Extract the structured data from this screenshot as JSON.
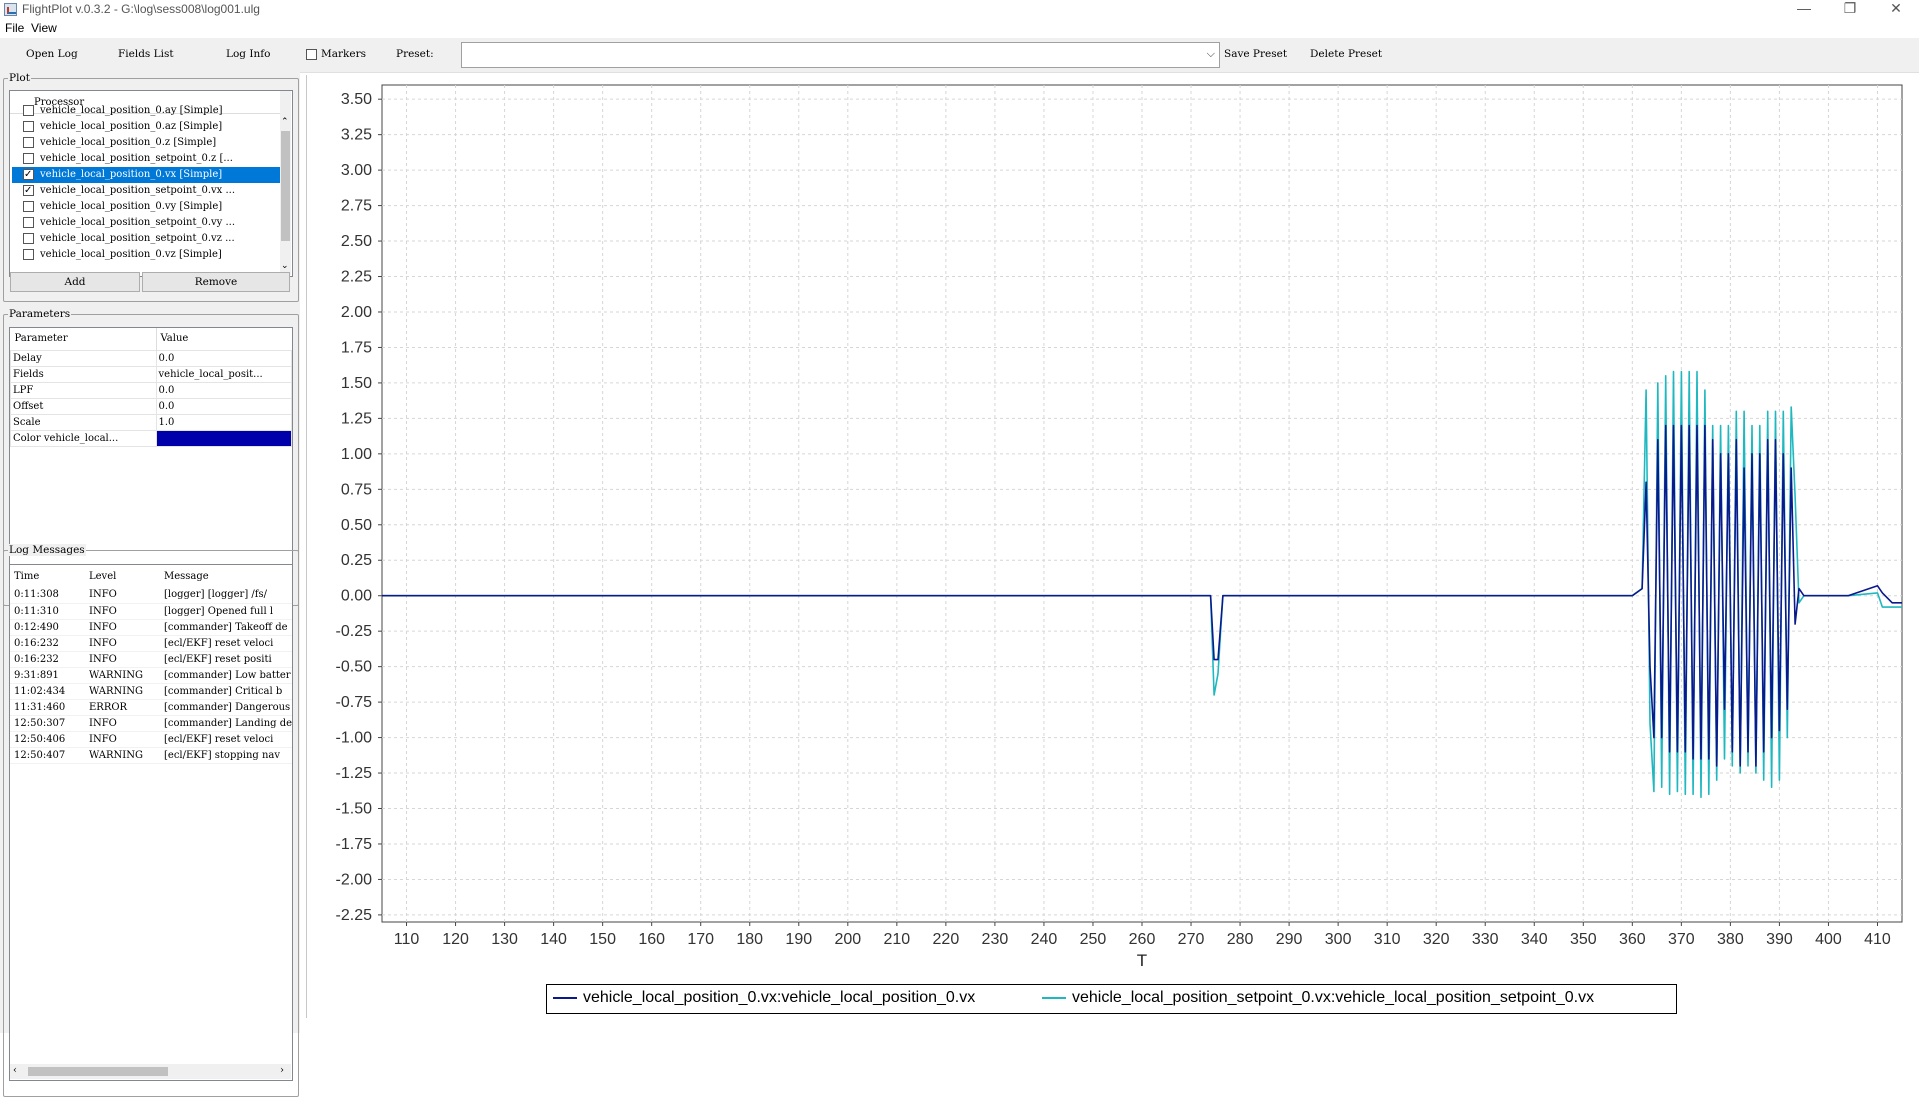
{
  "window": {
    "title": "FlightPlot v.0.3.2 - G:\\log\\sess008\\log001.ulg",
    "controls": [
      "—",
      "❐",
      "✕"
    ]
  },
  "menu": {
    "items": [
      "File",
      "View"
    ]
  },
  "toolbar": {
    "open_log": "Open Log",
    "fields_list": "Fields List",
    "log_info": "Log Info",
    "markers": "Markers",
    "preset_label": "Preset:",
    "preset_value": "",
    "save_preset": "Save Preset",
    "delete_preset": "Delete Preset"
  },
  "plot_panel": {
    "title": "Plot",
    "header": "Processor",
    "items": [
      {
        "label": "vehicle_local_position_0.ay [Simple]",
        "checked": false,
        "selected": false,
        "partial": true
      },
      {
        "label": "vehicle_local_position_0.az [Simple]",
        "checked": false,
        "selected": false
      },
      {
        "label": "vehicle_local_position_0.z [Simple]",
        "checked": false,
        "selected": false
      },
      {
        "label": "vehicle_local_position_setpoint_0.z [...",
        "checked": false,
        "selected": false
      },
      {
        "label": "vehicle_local_position_0.vx [Simple]",
        "checked": true,
        "selected": true
      },
      {
        "label": "vehicle_local_position_setpoint_0.vx ...",
        "checked": true,
        "selected": false
      },
      {
        "label": "vehicle_local_position_0.vy [Simple]",
        "checked": false,
        "selected": false
      },
      {
        "label": "vehicle_local_position_setpoint_0.vy ...",
        "checked": false,
        "selected": false
      },
      {
        "label": "vehicle_local_position_setpoint_0.vz ...",
        "checked": false,
        "selected": false
      },
      {
        "label": "vehicle_local_position_0.vz [Simple]",
        "checked": false,
        "selected": false
      }
    ],
    "add_label": "Add",
    "remove_label": "Remove"
  },
  "parameters": {
    "title": "Parameters",
    "headers": [
      "Parameter",
      "Value"
    ],
    "rows": [
      {
        "name": "Delay",
        "value": "0.0"
      },
      {
        "name": "Fields",
        "value": "vehicle_local_posit..."
      },
      {
        "name": "LPF",
        "value": "0.0"
      },
      {
        "name": "Offset",
        "value": "0.0"
      },
      {
        "name": "Scale",
        "value": "1.0"
      },
      {
        "name": "Color vehicle_local...",
        "value": "",
        "color": "#0000aa"
      }
    ]
  },
  "log_messages": {
    "title": "Log Messages",
    "headers": [
      "Time",
      "Level",
      "Message"
    ],
    "rows": [
      {
        "time": "0:11:308",
        "level": "INFO",
        "message": "[logger] [logger] /fs/"
      },
      {
        "time": "0:11:310",
        "level": "INFO",
        "message": "[logger] Opened full l"
      },
      {
        "time": "0:12:490",
        "level": "INFO",
        "message": "[commander] Takeoff de"
      },
      {
        "time": "0:16:232",
        "level": "INFO",
        "message": "[ecl/EKF] reset veloci"
      },
      {
        "time": "0:16:232",
        "level": "INFO",
        "message": "[ecl/EKF] reset positi"
      },
      {
        "time": "9:31:891",
        "level": "WARNING",
        "message": "[commander] Low batter"
      },
      {
        "time": "11:02:434",
        "level": "WARNING",
        "message": "[commander] Critical b"
      },
      {
        "time": "11:31:460",
        "level": "ERROR",
        "message": "[commander] Dangerous"
      },
      {
        "time": "12:50:307",
        "level": "INFO",
        "message": "[commander] Landing de"
      },
      {
        "time": "12:50:406",
        "level": "INFO",
        "message": "[ecl/EKF] reset veloci"
      },
      {
        "time": "12:50:407",
        "level": "WARNING",
        "message": "[ecl/EKF] stopping nav"
      }
    ]
  },
  "chart_data": {
    "type": "line",
    "xlabel": "T",
    "ylabel": "",
    "xlim": [
      105,
      415
    ],
    "ylim": [
      -2.3,
      3.6
    ],
    "xticks": [
      110,
      120,
      130,
      140,
      150,
      160,
      170,
      180,
      190,
      200,
      210,
      220,
      230,
      240,
      250,
      260,
      270,
      280,
      290,
      300,
      310,
      320,
      330,
      340,
      350,
      360,
      370,
      380,
      390,
      400,
      410
    ],
    "yticks": [
      3.5,
      3.25,
      3.0,
      2.75,
      2.5,
      2.25,
      2.0,
      1.75,
      1.5,
      1.25,
      1.0,
      0.75,
      0.5,
      0.25,
      0.0,
      -0.25,
      -0.5,
      -0.75,
      -1.0,
      -1.25,
      -1.5,
      -1.75,
      -2.0,
      -2.25
    ],
    "ytick_labels": [
      "3.50",
      "3.25",
      "3.00",
      "2.75",
      "2.50",
      "2.25",
      "2.00",
      "1.75",
      "1.50",
      "1.25",
      "1.00",
      "0.75",
      "0.50",
      "0.25",
      "0.00",
      "-0.25",
      "-0.50",
      "-0.75",
      "-1.00",
      "-1.25",
      "-1.50",
      "-1.75",
      "-2.00",
      "-2.25"
    ],
    "grid": true,
    "legend_position": "bottom-center",
    "series": [
      {
        "name": "vehicle_local_position_0.vx:vehicle_local_position_0.vx",
        "color": "#0a1a8c",
        "x": [
          105,
          274,
          274.7,
          275.5,
          276.5,
          360,
          362,
          362.8,
          363.6,
          364.4,
          365.2,
          366,
          366.8,
          367.6,
          368.4,
          369.2,
          370,
          370.8,
          371.6,
          372.4,
          373.2,
          374,
          374.8,
          375.6,
          376.4,
          377.2,
          378,
          378.8,
          379.6,
          380.4,
          381.2,
          382,
          382.8,
          383.6,
          384.4,
          385.2,
          386,
          386.8,
          387.6,
          388.4,
          389.2,
          390,
          390.8,
          391.6,
          392.4,
          393.2,
          394,
          395,
          400,
          404,
          410,
          411,
          413,
          415
        ],
        "y": [
          0,
          0,
          -0.45,
          -0.45,
          0,
          0,
          0.05,
          0.8,
          -0.5,
          -1.0,
          1.1,
          -1.0,
          1.2,
          -1.1,
          1.2,
          -1.1,
          1.2,
          -1.1,
          1.2,
          -1.15,
          1.2,
          -1.15,
          1.2,
          -1.15,
          1.1,
          -1.2,
          1.0,
          -0.8,
          1.0,
          -1.1,
          1.1,
          -1.2,
          0.9,
          -1.1,
          1.0,
          -1.2,
          1.0,
          -1.1,
          1.1,
          -1.0,
          1.1,
          -0.95,
          1.0,
          -0.8,
          0.9,
          -0.2,
          0.05,
          0,
          0,
          0,
          0.07,
          0.02,
          -0.05,
          -0.05
        ]
      },
      {
        "name": "vehicle_local_position_setpoint_0.vx:vehicle_local_position_setpoint_0.vx",
        "color": "#20b8c0",
        "x": [
          105,
          274,
          274.7,
          275.5,
          276.5,
          360,
          362,
          362.8,
          363.6,
          364.4,
          365.2,
          366,
          366.8,
          367.6,
          368.4,
          369.2,
          370,
          370.8,
          371.6,
          372.4,
          373.2,
          374,
          374.8,
          375.6,
          376.4,
          377.2,
          378,
          378.8,
          379.6,
          380.4,
          381.2,
          382,
          382.8,
          383.6,
          384.4,
          385.2,
          386,
          386.8,
          387.6,
          388.4,
          389.2,
          390,
          390.8,
          391.6,
          392.4,
          393.2,
          394,
          395,
          400,
          404,
          410,
          411,
          413,
          415
        ],
        "y": [
          0,
          0,
          -0.7,
          -0.55,
          0,
          0,
          0.05,
          1.45,
          -0.9,
          -1.38,
          1.5,
          -1.35,
          1.55,
          -1.4,
          1.58,
          -1.38,
          1.58,
          -1.4,
          1.58,
          -1.4,
          1.58,
          -1.42,
          1.45,
          -1.4,
          1.2,
          -1.3,
          1.2,
          -1.15,
          1.2,
          -1.2,
          1.3,
          -1.25,
          1.3,
          -1.2,
          1.2,
          -1.25,
          1.2,
          -1.3,
          1.3,
          -1.35,
          1.3,
          -1.3,
          1.3,
          -1.0,
          1.33,
          0.7,
          -0.05,
          0,
          0,
          0,
          0.02,
          -0.08,
          -0.08,
          -0.08
        ]
      }
    ]
  }
}
